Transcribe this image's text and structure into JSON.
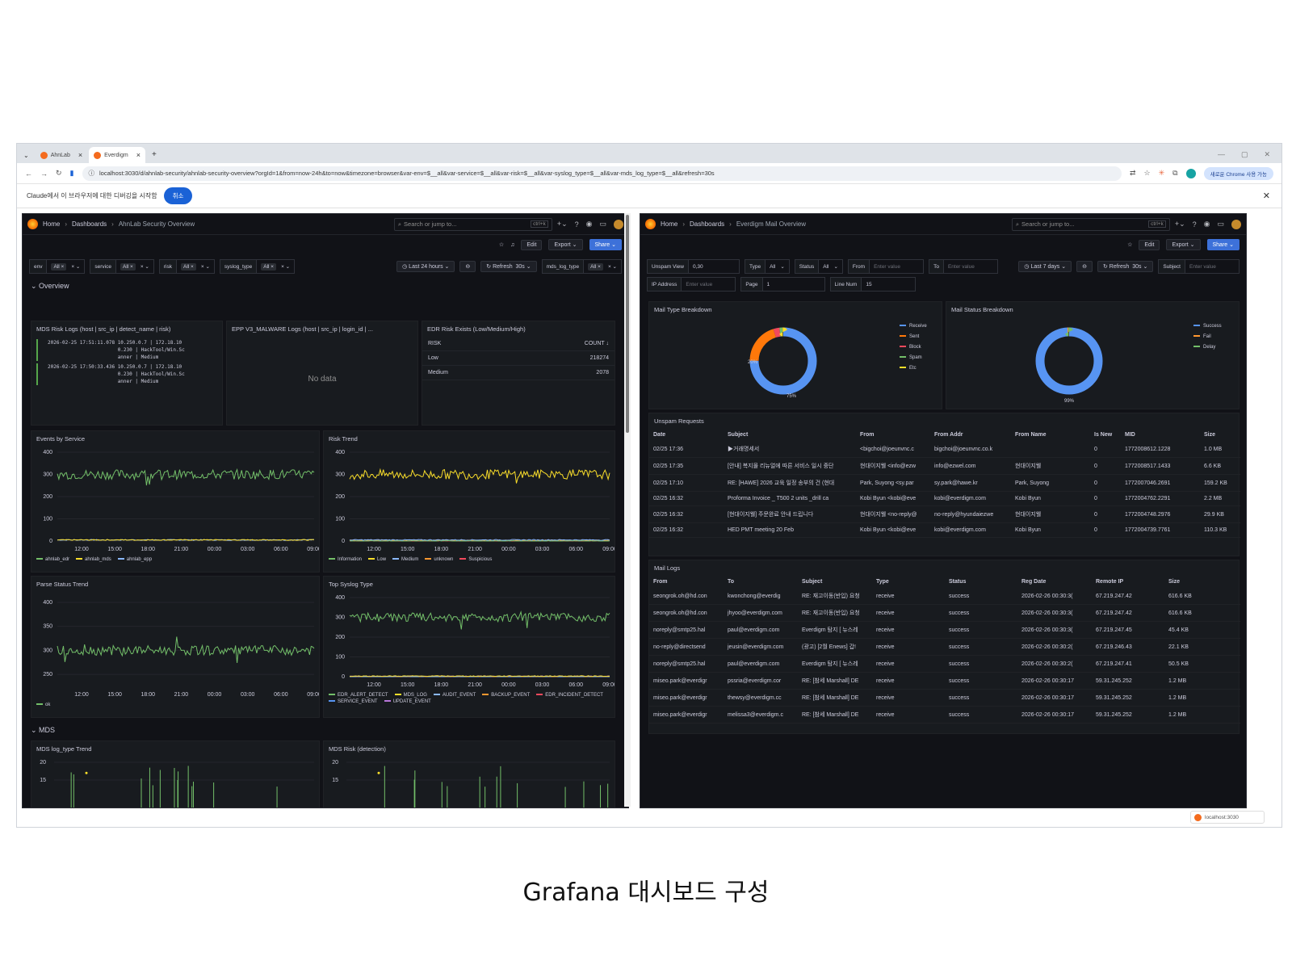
{
  "browser": {
    "tabs": [
      {
        "label": "AhnLab"
      },
      {
        "label": "Everdigm"
      }
    ],
    "url": "localhost:3030/d/ahnlab-security/ahnlab-security-overview?orgId=1&from=now-24h&to=now&timezone=browser&var-env=$__all&var-service=$__all&var-risk=$__all&var-syslog_type=$__all&var-mds_log_type=$__all&refresh=30s",
    "chrome_button": "새로운 Chrome 사용 가능",
    "infobar_text": "Claude에서 이 브라우저에 대한 디버깅을 시작함",
    "infobar_cancel": "취소",
    "toast": "localhost:3030"
  },
  "left": {
    "breadcrumb": [
      "Home",
      "Dashboards",
      "AhnLab Security Overview"
    ],
    "search_placeholder": "Search or jump to...",
    "search_shortcut": "ctrl+k",
    "toolbar": {
      "edit": "Edit",
      "export": "Export",
      "share": "Share"
    },
    "variables": [
      {
        "label": "env",
        "value": "All"
      },
      {
        "label": "service",
        "value": "All"
      },
      {
        "label": "risk",
        "value": "All"
      },
      {
        "label": "syslog_type",
        "value": "All"
      },
      {
        "label": "mds_log_type",
        "value": "All"
      }
    ],
    "time_range": "Last 24 hours",
    "refresh": "Refresh",
    "refresh_interval": "30s",
    "section_overview": "Overview",
    "section_mds": "MDS",
    "mds_logs": {
      "title": "MDS Risk Logs (host | src_ip | detect_name | risk)",
      "lines": [
        "2026-02-25 17:51:11.078 10.250.0.7 | 172.18.10\n                        0.230 | HackTool/Win.Sc\n                        anner | Medium",
        "2026-02-25 17:50:33.436 10.250.0.7 | 172.18.10\n                        0.230 | HackTool/Win.Sc\n                        anner | Medium"
      ]
    },
    "epp_logs": {
      "title": "EPP V3_MALWARE Logs (host | src_ip | login_id | ...",
      "empty": "No data"
    },
    "edr_risk": {
      "title": "EDR Risk Exists (Low/Medium/High)",
      "col_risk": "RISK",
      "col_count": "COUNT",
      "rows": [
        {
          "risk": "Low",
          "count": "218274"
        },
        {
          "risk": "Medium",
          "count": "2078"
        }
      ]
    },
    "events_by_service": {
      "title": "Events by Service",
      "legend": [
        "ahnlab_edr",
        "ahnlab_mds",
        "ahnlab_epp"
      ]
    },
    "risk_trend": {
      "title": "Risk Trend",
      "legend": [
        "Information",
        "Low",
        "Medium",
        "unknown",
        "Suspicious"
      ]
    },
    "parse_status": {
      "title": "Parse Status Trend",
      "legend": [
        "ok"
      ]
    },
    "top_syslog": {
      "title": "Top Syslog Type",
      "legend": [
        "EDR_ALERT_DETECT",
        "MDS_LOG",
        "AUDIT_EVENT",
        "BACKUP_EVENT",
        "EDR_INCIDENT_DETECT",
        "SERVICE_EVENT",
        "UPDATE_EVENT"
      ]
    },
    "mds_logtype_trend": {
      "title": "MDS log_type Trend"
    },
    "mds_risk": {
      "title": "MDS Risk (detection)"
    }
  },
  "right": {
    "breadcrumb": [
      "Home",
      "Dashboards",
      "Everdigm Mail Overview"
    ],
    "search_placeholder": "Search or jump to...",
    "search_shortcut": "ctrl+k",
    "toolbar": {
      "edit": "Edit",
      "export": "Export",
      "share": "Share"
    },
    "variables": [
      {
        "label": "Unspam View",
        "value": "0,30",
        "placeholder": false
      },
      {
        "label": "Type",
        "value": "All",
        "placeholder": false
      },
      {
        "label": "Status",
        "value": "All",
        "placeholder": false
      },
      {
        "label": "From",
        "value": "Enter value",
        "placeholder": true
      },
      {
        "label": "To",
        "value": "Enter value",
        "placeholder": true
      },
      {
        "label": "Subject",
        "value": "Enter value",
        "placeholder": true
      },
      {
        "label": "IP Address",
        "value": "Enter value",
        "placeholder": true
      },
      {
        "label": "Page",
        "value": "1",
        "placeholder": false
      },
      {
        "label": "Line Num",
        "value": "15",
        "placeholder": false
      }
    ],
    "time_range": "Last 7 days",
    "refresh": "Refresh",
    "refresh_interval": "30s",
    "mail_type": {
      "title": "Mail Type Breakdown",
      "legend": [
        "Receive",
        "Sent",
        "Block",
        "Spam",
        "Etc"
      ],
      "label_big": "75%",
      "label_small": "20%"
    },
    "mail_status": {
      "title": "Mail Status Breakdown",
      "legend": [
        "Success",
        "Fail",
        "Delay"
      ],
      "label_big": "99%"
    },
    "unspam": {
      "title": "Unspam Requests",
      "columns": [
        "Date",
        "Subject",
        "From",
        "From Addr",
        "From Name",
        "Is New",
        "MID",
        "Size"
      ],
      "rows": [
        [
          "02/25 17:36",
          "▶거래명세서",
          "<bigchoi@joeunvnc.c",
          "bigchoi@joeunvnc.co.k",
          "",
          "0",
          "1772008612.1228",
          "1.0 MB"
        ],
        [
          "02/25 17:35",
          "[안내] 복지몰 리뉴얼에 따른 서비스 일시 중단",
          "현대이지웰 <info@ezw",
          "info@ezwel.com",
          "현대이지웰",
          "0",
          "1772008517.1433",
          "6.6 KB"
        ],
        [
          "02/25 17:10",
          "RE: [HAWE] 2026 교육 일정 송부의 건 (현대",
          "Park, Suyong <sy.par",
          "sy.park@hawe.kr",
          "Park, Suyong",
          "0",
          "1772007046.2691",
          "159.2 KB"
        ],
        [
          "02/25 16:32",
          "Proforma Invoice _ T500 2 units _drill ca",
          "Kobi Byun <kobi@eve",
          "kobi@everdigm.com",
          "Kobi Byun",
          "0",
          "1772004762.2291",
          "2.2 MB"
        ],
        [
          "02/25 16:32",
          "[현대이지웰] 주문완료 안내 드립니다",
          "현대이지웰 <no-reply@",
          "no-reply@hyundaiezwe",
          "현대이지웰",
          "0",
          "1772004748.2976",
          "29.9 KB"
        ],
        [
          "02/25 16:32",
          "HED PMT meeting 20 Feb",
          "Kobi Byun <kobi@eve",
          "kobi@everdigm.com",
          "Kobi Byun",
          "0",
          "1772004739.7761",
          "110.3 KB"
        ]
      ]
    },
    "mail_logs": {
      "title": "Mail Logs",
      "columns": [
        "From",
        "To",
        "Subject",
        "Type",
        "Status",
        "Reg Date",
        "Remote IP",
        "Size"
      ],
      "rows": [
        [
          "seongrok.oh@hd.con",
          "kwonchong@everdig",
          "RE: 재고이동(반입) 요청",
          "receive",
          "success",
          "2026-02-26 00:30:3(",
          "67.219.247.42",
          "616.6 KB"
        ],
        [
          "seongrok.oh@hd.con",
          "jhyoo@everdigm.com",
          "RE: 재고이동(반입) 요청",
          "receive",
          "success",
          "2026-02-26 00:30:3(",
          "67.219.247.42",
          "616.6 KB"
        ],
        [
          "noreply@smtp25.hal",
          "paul@everdigm.com",
          "Everdigm 탐지 [ 뉴스레",
          "receive",
          "success",
          "2026-02-26 00:30:3(",
          "67.219.247.45",
          "45.4 KB"
        ],
        [
          "no-reply@directsend",
          "jeusin@everdigm.com",
          "(광고) [2월 Enews] 갑!",
          "receive",
          "success",
          "2026-02-26 00:30:2(",
          "67.219.246.43",
          "22.1 KB"
        ],
        [
          "noreply@smtp25.hal",
          "paul@everdigm.com",
          "Everdigm 탐지 [ 뉴스레",
          "receive",
          "success",
          "2026-02-26 00:30:2(",
          "67.219.247.41",
          "50.5 KB"
        ],
        [
          "miseo.park@everdigr",
          "pssria@everdigm.cor",
          "RE: [참세 Marshall] DE",
          "receive",
          "success",
          "2026-02-26 00:30:17",
          "59.31.245.252",
          "1.2 MB"
        ],
        [
          "miseo.park@everdigr",
          "thewsy@everdigm.cc",
          "RE: [참세 Marshall] DE",
          "receive",
          "success",
          "2026-02-26 00:30:17",
          "59.31.245.252",
          "1.2 MB"
        ],
        [
          "miseo.park@everdigr",
          "melissa3@everdigm.c",
          "RE: [참세 Marshall] DE",
          "receive",
          "success",
          "2026-02-26 00:30:17",
          "59.31.245.252",
          "1.2 MB"
        ]
      ]
    }
  },
  "caption": "Grafana 대시보드 구성",
  "chart_data": [
    {
      "type": "line",
      "title": "Events by Service",
      "x_ticks": [
        "12:00",
        "15:00",
        "18:00",
        "21:00",
        "00:00",
        "03:00",
        "06:00",
        "09:00"
      ],
      "y_ticks": [
        0,
        100,
        200,
        300,
        400
      ],
      "ylim": [
        0,
        400
      ],
      "series": [
        {
          "name": "ahnlab_edr",
          "approx_level": 300,
          "color": "#73bf69"
        },
        {
          "name": "ahnlab_mds",
          "approx_level": 5,
          "color": "#fade2a"
        },
        {
          "name": "ahnlab_epp",
          "approx_level": 5,
          "color": "#8ab8ff"
        }
      ]
    },
    {
      "type": "line",
      "title": "Risk Trend",
      "x_ticks": [
        "12:00",
        "15:00",
        "18:00",
        "21:00",
        "00:00",
        "03:00",
        "06:00",
        "09:00"
      ],
      "y_ticks": [
        0,
        100,
        200,
        300,
        400
      ],
      "ylim": [
        0,
        400
      ],
      "series": [
        {
          "name": "Information",
          "approx_level": 0,
          "color": "#73bf69"
        },
        {
          "name": "Low",
          "approx_level": 300,
          "color": "#fade2a"
        },
        {
          "name": "Medium",
          "approx_level": 5,
          "color": "#8ab8ff"
        },
        {
          "name": "unknown",
          "approx_level": 3,
          "color": "#ff9830"
        },
        {
          "name": "Suspicious",
          "approx_level": 0,
          "color": "#f2495c"
        }
      ]
    },
    {
      "type": "line",
      "title": "Parse Status Trend",
      "x_ticks": [
        "12:00",
        "15:00",
        "18:00",
        "21:00",
        "00:00",
        "03:00",
        "06:00",
        "09:00"
      ],
      "y_ticks": [
        250,
        300,
        350,
        400
      ],
      "ylim": [
        225,
        410
      ],
      "series": [
        {
          "name": "ok",
          "approx_level": 300,
          "color": "#73bf69"
        }
      ]
    },
    {
      "type": "line",
      "title": "Top Syslog Type",
      "x_ticks": [
        "12:00",
        "15:00",
        "18:00",
        "21:00",
        "00:00",
        "03:00",
        "06:00",
        "09:00"
      ],
      "y_ticks": [
        0,
        100,
        200,
        300,
        400
      ],
      "ylim": [
        0,
        400
      ],
      "series": [
        {
          "name": "EDR_ALERT_DETECT",
          "approx_level": 300,
          "color": "#73bf69"
        },
        {
          "name": "MDS_LOG",
          "approx_level": 3,
          "color": "#fade2a"
        },
        {
          "name": "AUDIT_EVENT",
          "approx_level": 0,
          "color": "#8ab8ff"
        },
        {
          "name": "BACKUP_EVENT",
          "approx_level": 0,
          "color": "#ff9830"
        },
        {
          "name": "EDR_INCIDENT_DETECT",
          "approx_level": 0,
          "color": "#f2495c"
        },
        {
          "name": "SERVICE_EVENT",
          "approx_level": 0,
          "color": "#5794f2"
        },
        {
          "name": "UPDATE_EVENT",
          "approx_level": 2,
          "color": "#b877d9"
        }
      ]
    },
    {
      "type": "pie",
      "title": "Mail Type Breakdown",
      "slices": [
        {
          "name": "Receive",
          "value": 75,
          "color": "#5794f2"
        },
        {
          "name": "Sent",
          "value": 20,
          "color": "#ff780a"
        },
        {
          "name": "Block",
          "value": 3,
          "color": "#f2495c"
        },
        {
          "name": "Spam",
          "value": 1.5,
          "color": "#73bf69"
        },
        {
          "name": "Etc",
          "value": 0.5,
          "color": "#fade2a"
        }
      ]
    },
    {
      "type": "pie",
      "title": "Mail Status Breakdown",
      "slices": [
        {
          "name": "Success",
          "value": 99,
          "color": "#5794f2"
        },
        {
          "name": "Fail",
          "value": 0.5,
          "color": "#ff9830"
        },
        {
          "name": "Delay",
          "value": 0.5,
          "color": "#73bf69"
        }
      ]
    }
  ]
}
